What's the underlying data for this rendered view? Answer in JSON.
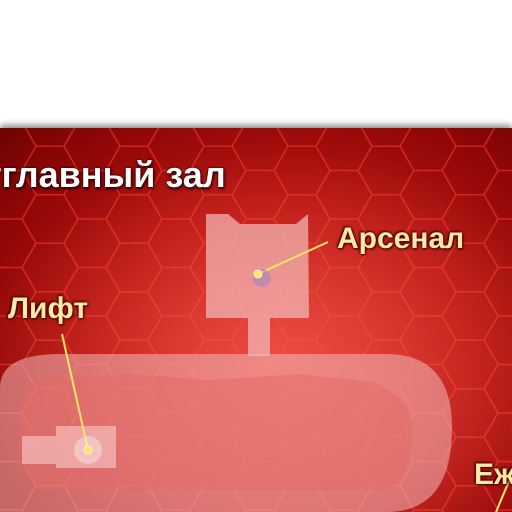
{
  "map": {
    "title": "тглавный зал",
    "labels": {
      "arsenal": "Арсенал",
      "lift": "Лифт",
      "edge": "Еж"
    },
    "colors": {
      "background": "#b81512",
      "hex_grid": "#ff3a2e",
      "room_fill": "#f3b8b8",
      "label_text": "#ffe9a8",
      "marker": "#ffe36a",
      "leader_line": "#ffe36a",
      "title_text": "#ffffff"
    },
    "icons": [
      "marker-dot",
      "leader-line"
    ]
  }
}
